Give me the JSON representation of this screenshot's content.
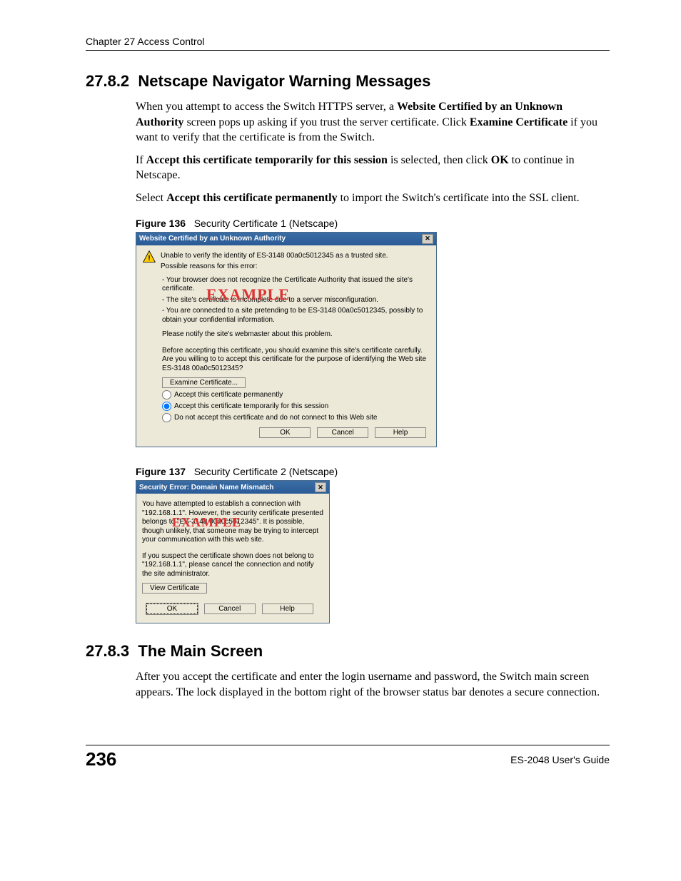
{
  "header": {
    "chapter": "Chapter 27 Access Control"
  },
  "section1": {
    "number": "27.8.2",
    "title": "Netscape Navigator Warning Messages",
    "para1_a": "When you attempt to access the Switch HTTPS server, a ",
    "para1_b": "Website Certified by an Unknown Authority",
    "para1_c": " screen pops up asking if you trust the server certificate. Click ",
    "para1_d": "Examine Certificate",
    "para1_e": " if you want to verify that the certificate is from the Switch.",
    "para2_a": "If ",
    "para2_b": "Accept this certificate temporarily for this session",
    "para2_c": " is selected, then click ",
    "para2_d": "OK",
    "para2_e": " to continue in Netscape.",
    "para3_a": "Select ",
    "para3_b": "Accept this certificate permanently",
    "para3_c": " to import the Switch's certificate into the SSL client."
  },
  "figure1": {
    "fignum": "Figure 136",
    "caption": "Security Certificate 1 (Netscape)",
    "dialog": {
      "title": "Website Certified by an Unknown Authority",
      "line_unable": "Unable to verify the identity of ES-3148 00a0c5012345 as a trusted site.",
      "line_reasons": "Possible reasons for this error:",
      "reason1": "- Your browser does not recognize the Certificate Authority that issued the site's certificate.",
      "reason2": "- The site's certificate is incomplete due to a server misconfiguration.",
      "reason3": "- You are connected to a site pretending to be ES-3148 00a0c5012345, possibly to obtain your confidential information.",
      "notify": "Please notify the site's webmaster about this problem.",
      "before": "Before accepting this certificate, you should examine this site's certificate carefully. Are you willing to to accept this certificate for the purpose of identifying the Web site ES-3148 00a0c5012345?",
      "examine_btn": "Examine Certificate...",
      "opt1": "Accept this certificate permanently",
      "opt2": "Accept this certificate temporarily for this session",
      "opt3": "Do not accept this certificate and do not connect to this Web site",
      "ok": "OK",
      "cancel": "Cancel",
      "help": "Help",
      "stamp": "EXAMPLE"
    }
  },
  "figure2": {
    "fignum": "Figure 137",
    "caption": "Security Certificate 2 (Netscape)",
    "dialog": {
      "title": "Security Error: Domain Name Mismatch",
      "p1": "You have attempted to establish a connection with \"192.168.1.1\". However, the security certificate presented belongs to \"ES-3148 00a0c5012345\". It is possible, though unlikely, that someone may be trying to intercept your communication with this web site.",
      "p2": "If you suspect the certificate shown does not belong to \"192.168.1.1\", please cancel the connection and notify the site administrator.",
      "view_btn": "View Certificate",
      "ok": "OK",
      "cancel": "Cancel",
      "help": "Help",
      "stamp": "EXAMPLE"
    }
  },
  "section2": {
    "number": "27.8.3",
    "title": "The Main Screen",
    "para1": "After you accept the certificate and enter the login username and password, the Switch main screen appears. The lock displayed in the bottom right of the browser status bar denotes a secure connection."
  },
  "footer": {
    "page": "236",
    "guide": "ES-2048 User's Guide"
  }
}
